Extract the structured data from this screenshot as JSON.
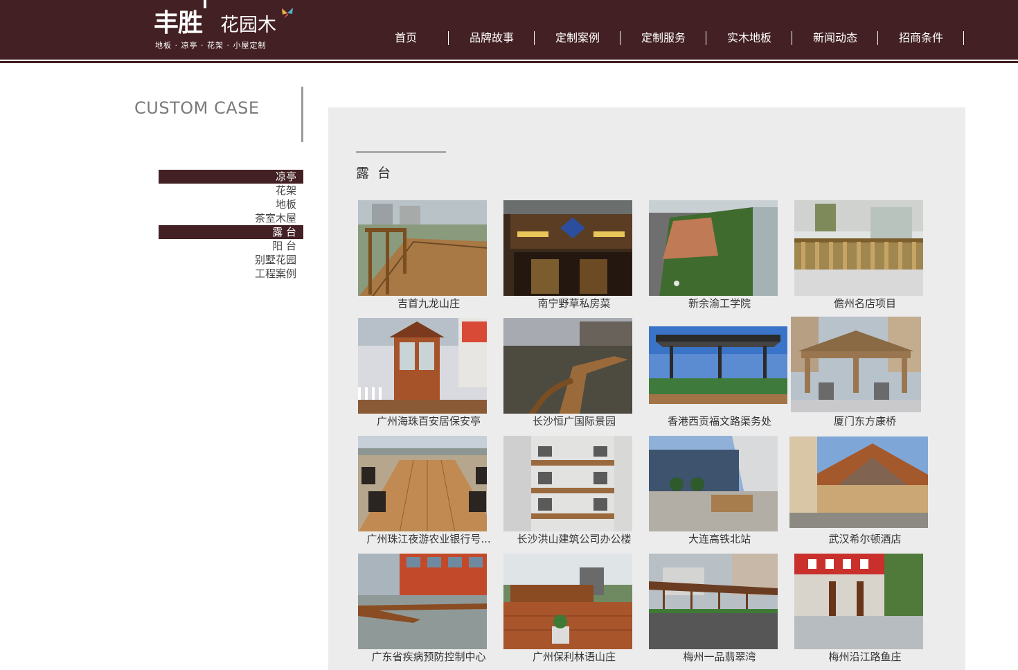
{
  "brand": {
    "mark": "丰胜",
    "name": "花园木",
    "tagline": "地板 · 凉亭 · 花架 · 小屋定制"
  },
  "nav": [
    "首页",
    "品牌故事",
    "定制案例",
    "定制服务",
    "实木地板",
    "新闻动态",
    "招商条件"
  ],
  "section": {
    "title": "CUSTOM CASE",
    "current": "露 台"
  },
  "side_menu": [
    {
      "label": "凉亭",
      "active": true
    },
    {
      "label": "花架",
      "active": false
    },
    {
      "label": "地板",
      "active": false
    },
    {
      "label": "茶室木屋",
      "active": false
    },
    {
      "label": "露 台",
      "active": true
    },
    {
      "label": "阳 台",
      "active": false
    },
    {
      "label": "别墅花园",
      "active": false
    },
    {
      "label": "工程案例",
      "active": false
    }
  ],
  "cases": [
    {
      "title": "吉首九龙山庄",
      "scene": "deck-rail"
    },
    {
      "title": "南宁野草私房菜",
      "scene": "storefront"
    },
    {
      "title": "新余渝工学院",
      "scene": "rooftop-lawn"
    },
    {
      "title": "儋州名店项目",
      "scene": "fence-white"
    },
    {
      "title": "广州海珠百安居保安亭",
      "scene": "kiosk"
    },
    {
      "title": "长沙恒广国际景园",
      "scene": "pond-walk"
    },
    {
      "title": "香港西贡福文路渠务处",
      "scene": "canopy"
    },
    {
      "title": "厦门东方康桥",
      "scene": "pergola"
    },
    {
      "title": "广州珠江夜游农业银行号...",
      "scene": "boat-deck"
    },
    {
      "title": "长沙洪山建筑公司办公楼",
      "scene": "atrium"
    },
    {
      "title": "大连高铁北站",
      "scene": "station"
    },
    {
      "title": "武汉希尔顿酒店",
      "scene": "hotel"
    },
    {
      "title": "广东省疾病预防控制中心",
      "scene": "waterfront"
    },
    {
      "title": "广州保利林语山庄",
      "scene": "garden-deck"
    },
    {
      "title": "梅州一品翡翠湾",
      "scene": "walkway"
    },
    {
      "title": "梅州沿江路鱼庄",
      "scene": "restaurant"
    }
  ],
  "colors": {
    "brand": "#432023",
    "panel": "#ececec"
  }
}
